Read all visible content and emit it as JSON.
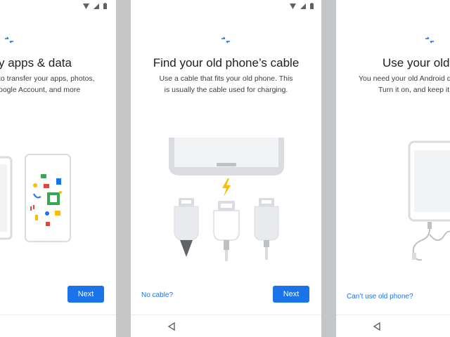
{
  "screens": [
    {
      "title": "y apps & data",
      "description_lines": [
        "to transfer your apps, photos,",
        "oogle Account, and more"
      ],
      "next_label": "Next"
    },
    {
      "title": "Find your old phone’s cable",
      "description_lines": [
        "Use a cable that fits your old phone. This",
        "is usually the cable used for charging."
      ],
      "next_label": "Next",
      "link_label": "No cable?"
    },
    {
      "title": "Use your old p",
      "description_lines": [
        "You need your old Android d",
        "Turn it on, and keep it"
      ],
      "link_label": "Can’t use old phone?"
    }
  ],
  "icons": {
    "status": [
      "wifi-icon",
      "signal-icon",
      "battery-icon"
    ],
    "header": "transfer-arrows-icon",
    "nav": "back-triangle-icon"
  },
  "colors": {
    "accent": "#1a73e8",
    "title": "#202124",
    "body_text": "#3c4043",
    "divider_background": "#c5c6c7",
    "illustration_gray": "#dadce0",
    "lightning": "#fbbc04"
  }
}
